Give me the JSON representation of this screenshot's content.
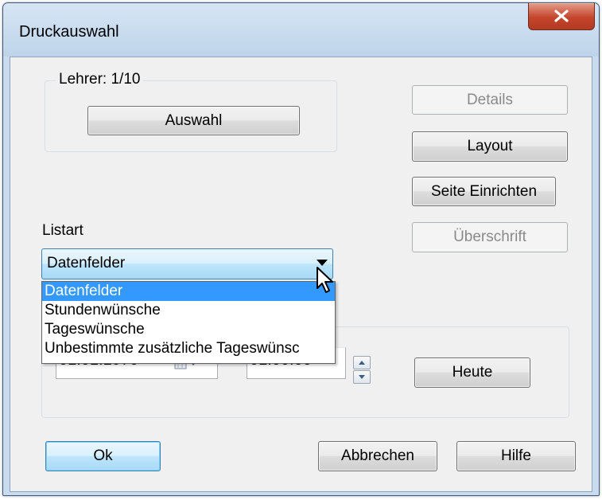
{
  "window": {
    "title": "Druckauswahl",
    "close_icon": "close-icon"
  },
  "teacher_group": {
    "label": "Lehrer: 1/10",
    "select_button": "Auswahl"
  },
  "side_buttons": {
    "details": "Details",
    "layout": "Layout",
    "page_setup": "Seite Einrichten",
    "heading": "Überschrift"
  },
  "list_type": {
    "label": "Listart",
    "selected": "Datenfelder",
    "options": [
      "Datenfelder",
      "Stundenwünsche",
      "Tageswünsche",
      "Unbestimmte zusätzliche Tageswünsc"
    ]
  },
  "date_group": {
    "date_value": "01.01.1970",
    "time_value": "01:00:00",
    "today_button": "Heute"
  },
  "footer": {
    "ok": "Ok",
    "cancel": "Abbrechen",
    "help": "Hilfe"
  },
  "colors": {
    "selection": "#3399ff",
    "close_button": "#c4452c",
    "frame": "#c9dcef",
    "client": "#f0f0f0"
  }
}
